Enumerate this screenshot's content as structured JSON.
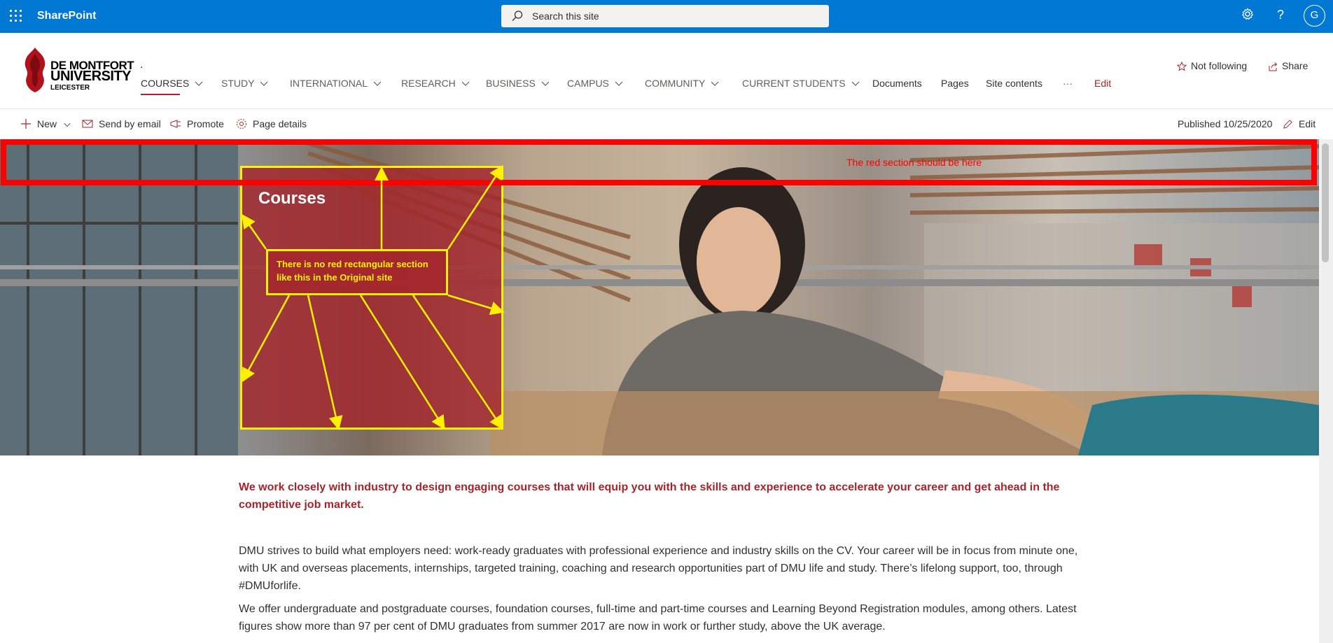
{
  "suite": {
    "brand": "SharePoint",
    "search_placeholder": "Search this site",
    "avatar_initial": "G"
  },
  "site": {
    "logo": {
      "line1": "DE MONTFORT",
      "line2": "UNIVERSITY",
      "line3": "LEICESTER"
    },
    "title": "."
  },
  "nav": [
    {
      "label": "COURSES",
      "has_menu": true,
      "active": true
    },
    {
      "label": "STUDY",
      "has_menu": true
    },
    {
      "label": "INTERNATIONAL",
      "has_menu": true
    },
    {
      "label": "RESEARCH",
      "has_menu": true
    },
    {
      "label": "BUSINESS",
      "has_menu": true
    },
    {
      "label": "CAMPUS",
      "has_menu": true
    },
    {
      "label": "COMMUNITY",
      "has_menu": true
    },
    {
      "label": "CURRENT STUDENTS",
      "has_menu": true
    },
    {
      "label": "Documents"
    },
    {
      "label": "Pages"
    },
    {
      "label": "Site contents"
    },
    {
      "label": "···"
    },
    {
      "label": "Edit"
    }
  ],
  "header_actions": {
    "follow": "Not following",
    "share": "Share"
  },
  "commands": {
    "new": "New",
    "send_email": "Send by email",
    "promote": "Promote",
    "page_details": "Page details",
    "published": "Published 10/25/2020",
    "edit": "Edit"
  },
  "hero": {
    "title": "Courses",
    "annotation_callout": "There is no red rectangular section like this in the Original site",
    "annotation_top": "The red section should be here"
  },
  "content": {
    "lead": "We work closely with industry to design engaging courses that will equip you with the skills and experience to accelerate your career and get ahead in the competitive job market.",
    "para1": "DMU strives to build what employers need: work-ready graduates with professional experience and industry skills on the CV. Your career will be in focus from minute one, with UK and overseas placements, internships, targeted training, coaching and research opportunities part of DMU life and study. There’s lifelong support, too, through #DMUforlife.",
    "para2": "We offer undergraduate and postgraduate courses, foundation courses, full-time and part-time courses and Learning Beyond Registration modules, among others. Latest figures show more than 97 per cent of DMU graduates from summer 2017 are now in work or further study, above the UK average."
  },
  "colors": {
    "suitebar": "#0078d4",
    "accent": "#a4262c",
    "annotation_yellow": "#fff200",
    "annotation_red": "#ff0000"
  },
  "icons": [
    "waffle-icon",
    "search-icon",
    "settings-icon",
    "help-icon",
    "star-icon",
    "share-icon",
    "plus-icon",
    "mail-icon",
    "promote-icon",
    "page-details-icon",
    "edit-icon",
    "chevron-down-icon"
  ]
}
